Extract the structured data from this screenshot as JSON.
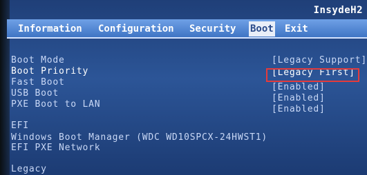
{
  "header": {
    "brand": "InsydeH2"
  },
  "tabs": [
    {
      "label": "Information"
    },
    {
      "label": "Configuration"
    },
    {
      "label": "Security"
    },
    {
      "label": "Boot"
    },
    {
      "label": "Exit"
    }
  ],
  "boot": {
    "items": [
      {
        "label": "Boot Mode",
        "value": "[Legacy Support]"
      },
      {
        "label": "Boot Priority",
        "value": "[Legacy First]"
      },
      {
        "label": "Fast Boot",
        "value": "[Enabled]"
      },
      {
        "label": "USB Boot",
        "value": "[Enabled]"
      },
      {
        "label": "PXE Boot to LAN",
        "value": "[Enabled]"
      }
    ],
    "efi_header": "EFI",
    "efi_items": [
      "Windows Boot Manager (WDC WD10SPCX-24HWST1)",
      "EFI PXE Network"
    ],
    "legacy_header": "Legacy"
  }
}
